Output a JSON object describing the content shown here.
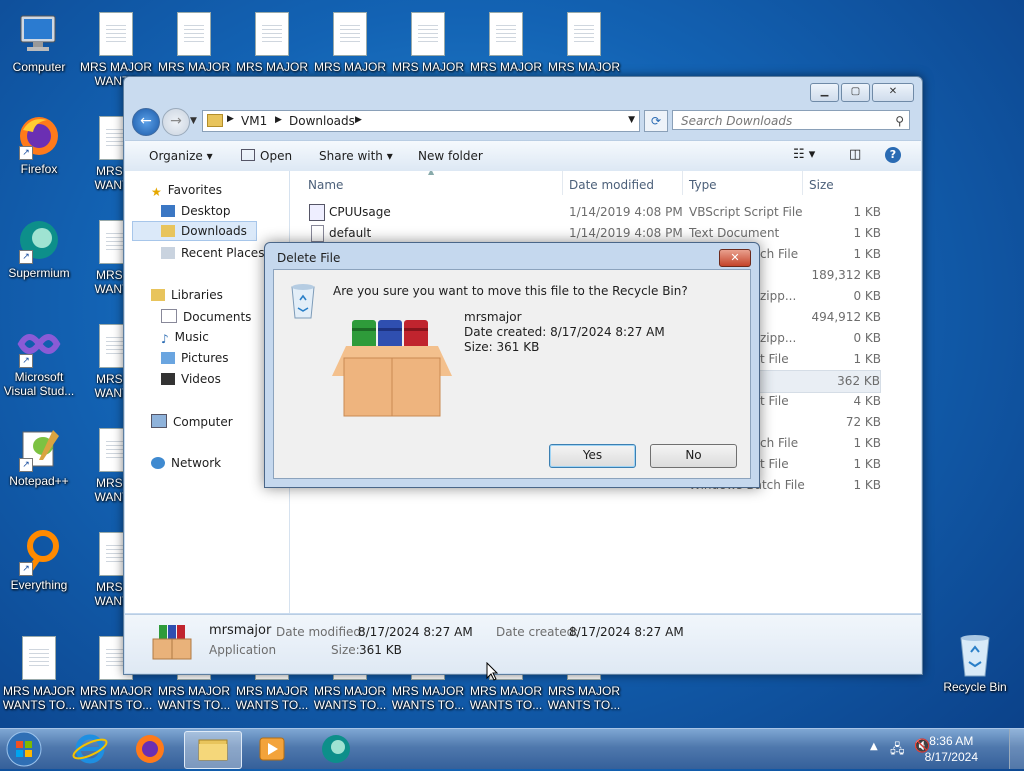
{
  "desktop": {
    "top_row": [
      {
        "label": "Computer"
      },
      {
        "label": "MRS MAJOR WANTS"
      },
      {
        "label": "MRS MAJOR"
      },
      {
        "label": "MRS MAJOR"
      },
      {
        "label": "MRS MAJOR"
      },
      {
        "label": "MRS MAJOR"
      },
      {
        "label": "MRS MAJOR"
      },
      {
        "label": "MRS MAJOR"
      }
    ],
    "left_col": [
      {
        "label": "Firefox"
      },
      {
        "label": "Supermium"
      },
      {
        "label": "Microsoft Visual Stud..."
      },
      {
        "label": "Notepad++"
      },
      {
        "label": "Everything"
      }
    ],
    "second_col": [
      {
        "label": "MRS M WANTS"
      },
      {
        "label": "MRS M WANTS"
      },
      {
        "label": "MRS M WANTS"
      },
      {
        "label": "MRS M WANTS"
      },
      {
        "label": "MRS M WANTS"
      }
    ],
    "bottom_row": [
      {
        "label": "MRS MAJOR WANTS TO..."
      },
      {
        "label": "MRS MAJOR WANTS TO..."
      },
      {
        "label": "MRS MAJOR WANTS TO..."
      },
      {
        "label": "MRS MAJOR WANTS TO..."
      },
      {
        "label": "MRS MAJOR WANTS TO..."
      },
      {
        "label": "MRS MAJOR WANTS TO..."
      },
      {
        "label": "MRS MAJOR WANTS TO..."
      },
      {
        "label": "MRS MAJOR WANTS TO..."
      }
    ],
    "recycle_bin": "Recycle Bin"
  },
  "explorer": {
    "breadcrumb": [
      "VM1",
      "Downloads"
    ],
    "search_placeholder": "Search Downloads",
    "toolbar": {
      "organize": "Organize",
      "open": "Open",
      "share": "Share with",
      "new_folder": "New folder"
    },
    "nav": {
      "favorites": "Favorites",
      "desktop": "Desktop",
      "downloads": "Downloads",
      "recent": "Recent Places",
      "libraries": "Libraries",
      "documents": "Documents",
      "music": "Music",
      "pictures": "Pictures",
      "videos": "Videos",
      "computer": "Computer",
      "network": "Network"
    },
    "columns": {
      "name": "Name",
      "date": "Date modified",
      "type": "Type",
      "size": "Size"
    },
    "files": [
      {
        "name": "CPUUsage",
        "date": "1/14/2019 4:08 PM",
        "type": "VBScript Script File",
        "size": "1 KB"
      },
      {
        "name": "default",
        "date": "1/14/2019 4:08 PM",
        "type": "Text Document",
        "size": "1 KB"
      },
      {
        "name": "",
        "date": "",
        "type": "ch File",
        "size": "1 KB"
      },
      {
        "name": "",
        "date": "",
        "type": "",
        "size": "189,312 KB"
      },
      {
        "name": "",
        "date": "",
        "type": "zipp...",
        "size": "0 KB"
      },
      {
        "name": "",
        "date": "",
        "type": "",
        "size": "494,912 KB"
      },
      {
        "name": "",
        "date": "",
        "type": "zipp...",
        "size": "0 KB"
      },
      {
        "name": "",
        "date": "",
        "type": "t File",
        "size": "1 KB"
      },
      {
        "name": "",
        "date": "",
        "type": "",
        "size": "362 KB"
      },
      {
        "name": "",
        "date": "",
        "type": "t File",
        "size": "4 KB"
      },
      {
        "name": "",
        "date": "",
        "type": "",
        "size": "72 KB"
      },
      {
        "name": "",
        "date": "",
        "type": "ch File",
        "size": "1 KB"
      },
      {
        "name": "",
        "date": "",
        "type": "t File",
        "size": "1 KB"
      },
      {
        "name": "",
        "date": "",
        "type": "Windows Batch File",
        "size": "1 KB"
      }
    ],
    "details": {
      "name": "mrsmajor",
      "kind": "Application",
      "date_modified_label": "Date modified:",
      "date_modified": "8/17/2024 8:27 AM",
      "date_created_label": "Date created:",
      "date_created": "8/17/2024 8:27 AM",
      "size_label": "Size:",
      "size": "361 KB"
    }
  },
  "dialog": {
    "title": "Delete File",
    "question": "Are you sure you want to move this file to the Recycle Bin?",
    "file_name": "mrsmajor",
    "date_created": "Date created: 8/17/2024 8:27 AM",
    "size": "Size: 361 KB",
    "yes": "Yes",
    "no": "No"
  },
  "taskbar": {
    "time": "8:36 AM",
    "date": "8/17/2024"
  },
  "colors": {
    "selection": "#cde8ff",
    "accent": "#1c5aa8"
  }
}
